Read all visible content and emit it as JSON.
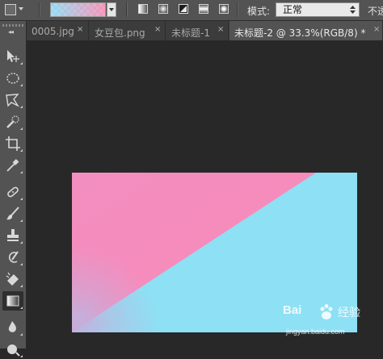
{
  "options_bar": {
    "tool_preset_icon": "gradient-tool-preset-icon",
    "gradient_colors": [
      "#8cdcf6",
      "#fa8cb4"
    ],
    "gradient_types": [
      {
        "name": "linear",
        "selected": false
      },
      {
        "name": "radial",
        "selected": false
      },
      {
        "name": "angle",
        "selected": true
      },
      {
        "name": "reflected",
        "selected": false
      },
      {
        "name": "diamond",
        "selected": false
      }
    ],
    "mode_label": "模式:",
    "mode_value": "正常",
    "opacity_label": "不透"
  },
  "tabs": [
    {
      "label": "0005.jpg",
      "close": "×",
      "active": false
    },
    {
      "label": "女豆包.png",
      "close": "×",
      "active": false
    },
    {
      "label": "未标题-1",
      "close": "×",
      "active": false
    },
    {
      "label": "未标题-2 @ 33.3%(RGB/8) *",
      "close": "×",
      "active": true
    }
  ],
  "tools": [
    {
      "name": "move-tool-icon"
    },
    {
      "name": "marquee-tool-icon"
    },
    {
      "name": "lasso-tool-icon"
    },
    {
      "name": "quick-select-tool-icon"
    },
    {
      "name": "crop-tool-icon"
    },
    {
      "name": "eyedropper-tool-icon"
    },
    {
      "name": "healing-brush-tool-icon"
    },
    {
      "name": "brush-tool-icon"
    },
    {
      "name": "clone-stamp-tool-icon"
    },
    {
      "name": "history-brush-tool-icon"
    },
    {
      "name": "eraser-tool-icon"
    },
    {
      "name": "gradient-tool-icon",
      "active": true
    },
    {
      "name": "blur-tool-icon"
    },
    {
      "name": "dodge-tool-icon"
    }
  ],
  "canvas": {
    "colors": {
      "pink": "#f98ab8",
      "cyan": "#8ee0f4",
      "blend": "#c3b0dc"
    }
  },
  "watermark": {
    "brand_left": "Bai",
    "brand_right": "经验",
    "url": "jingyan.baidu.com"
  }
}
